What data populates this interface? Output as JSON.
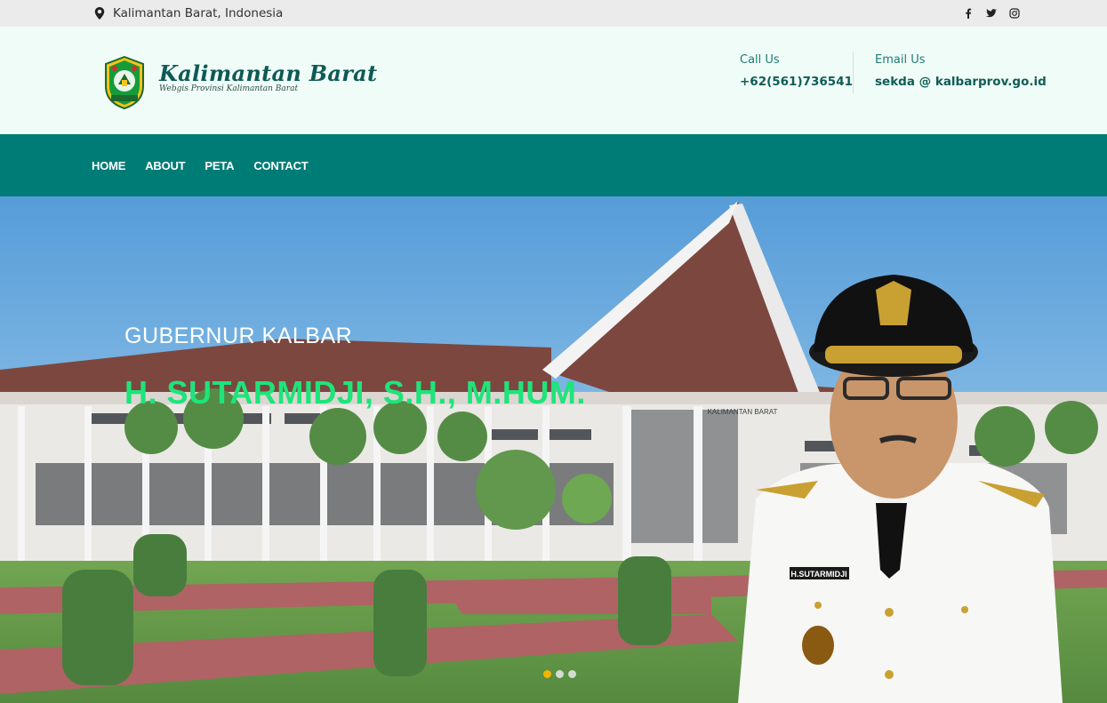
{
  "topbar": {
    "location": "Kalimantan Barat, Indonesia",
    "social_icons": [
      "facebook-icon",
      "twitter-icon",
      "instagram-icon"
    ]
  },
  "header": {
    "brand_title": "Kalimantan Barat",
    "brand_subtitle": "Webgis Provinsi Kalimantan Barat",
    "call_label": "Call Us",
    "call_value": "+62(561)736541",
    "email_label": "Email Us",
    "email_value": "sekda @ kalbarprov.go.id"
  },
  "nav": {
    "items": [
      {
        "label": "HOME"
      },
      {
        "label": "ABOUT"
      },
      {
        "label": "PETA"
      },
      {
        "label": "CONTACT"
      }
    ]
  },
  "hero": {
    "subtitle": "GUBERNUR KALBAR",
    "title": "H. SUTARMIDJI, S.H., M.HUM.",
    "slide_count": 3,
    "active_slide": 1,
    "building_sign": "KALIMANTAN BARAT",
    "name_tag": "H.SUTARMIDJI"
  },
  "colors": {
    "nav_bg": "#007c76",
    "header_bg": "#f0fcf7",
    "topbar_bg": "#ebebeb",
    "hero_title": "#1ee47a",
    "active_dot": "#f4b400"
  }
}
